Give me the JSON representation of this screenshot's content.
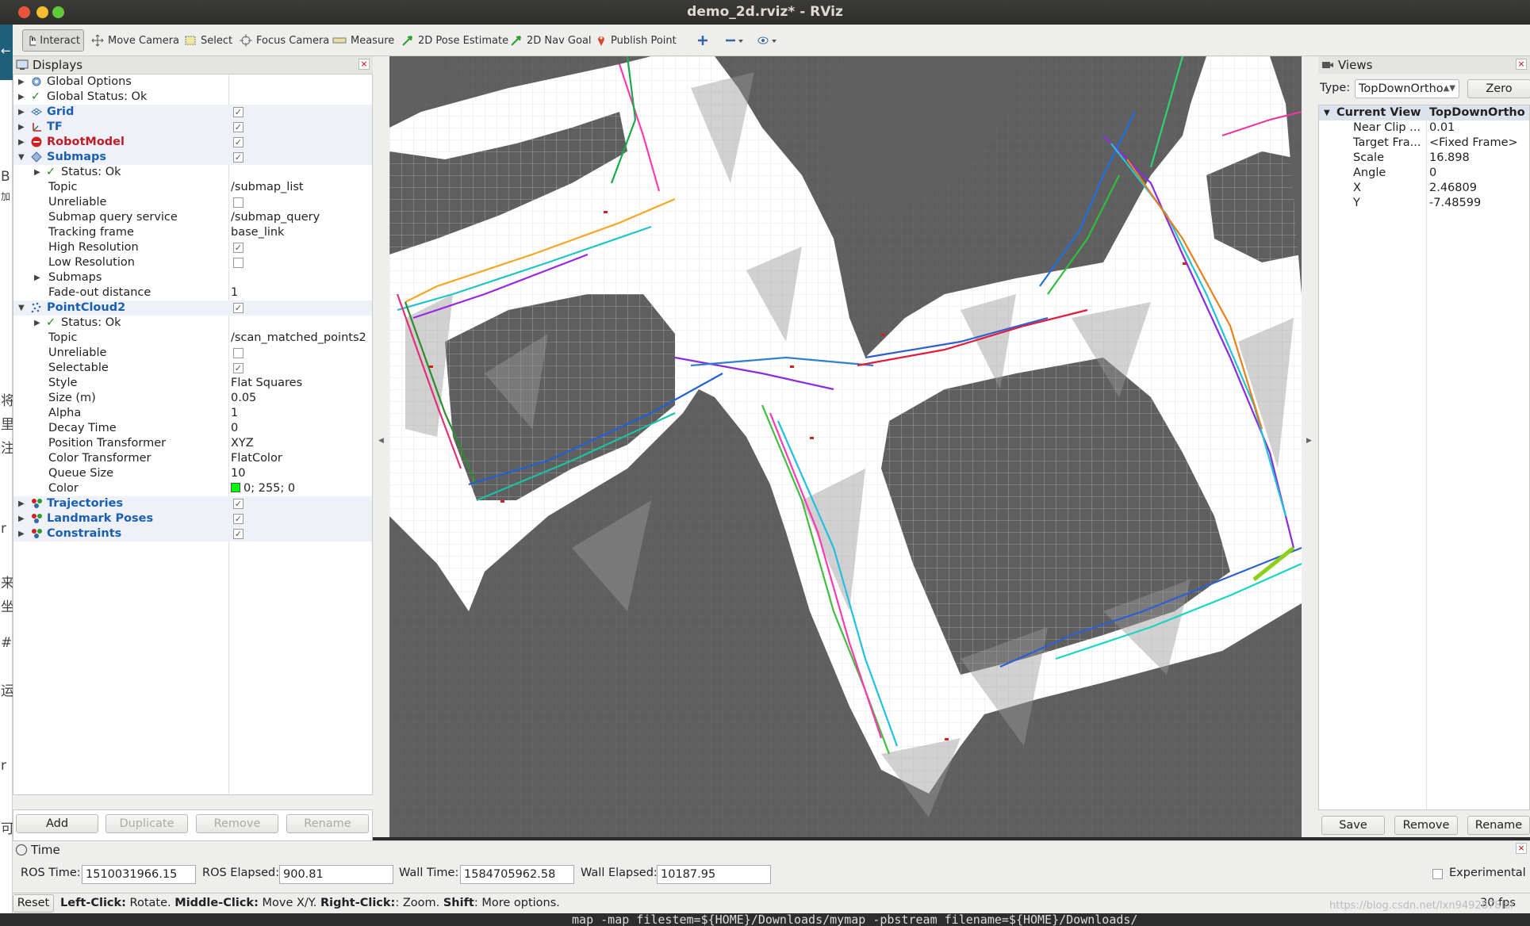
{
  "window": {
    "title": "demo_2d.rviz* - RViz"
  },
  "toolbar": {
    "tools": [
      {
        "label": "Interact"
      },
      {
        "label": "Move Camera"
      },
      {
        "label": "Select"
      },
      {
        "label": "Focus Camera"
      },
      {
        "label": "Measure"
      },
      {
        "label": "2D Pose Estimate"
      },
      {
        "label": "2D Nav Goal"
      },
      {
        "label": "Publish Point"
      }
    ]
  },
  "left_strip": {
    "glyphs": [
      "B",
      "加",
      "将",
      "里",
      "注",
      "r",
      "来",
      "坐",
      "#",
      "运",
      "r",
      "可"
    ]
  },
  "displays": {
    "title": "Displays",
    "rows": [
      {
        "label": "Global Options",
        "value": ""
      },
      {
        "label": "Global Status: Ok",
        "value": ""
      },
      {
        "label": "Grid",
        "value": ""
      },
      {
        "label": "TF",
        "value": ""
      },
      {
        "label": "RobotModel",
        "value": ""
      },
      {
        "label": "Submaps",
        "value": ""
      },
      {
        "label": "Status: Ok",
        "value": ""
      },
      {
        "label": "Topic",
        "value": "/submap_list"
      },
      {
        "label": "Unreliable",
        "value": ""
      },
      {
        "label": "Submap query service",
        "value": "/submap_query"
      },
      {
        "label": "Tracking frame",
        "value": "base_link"
      },
      {
        "label": "High Resolution",
        "value": ""
      },
      {
        "label": "Low Resolution",
        "value": ""
      },
      {
        "label": "Submaps",
        "value": ""
      },
      {
        "label": "Fade-out distance",
        "value": "1"
      },
      {
        "label": "PointCloud2",
        "value": ""
      },
      {
        "label": "Status: Ok",
        "value": ""
      },
      {
        "label": "Topic",
        "value": "/scan_matched_points2"
      },
      {
        "label": "Unreliable",
        "value": ""
      },
      {
        "label": "Selectable",
        "value": ""
      },
      {
        "label": "Style",
        "value": "Flat Squares"
      },
      {
        "label": "Size (m)",
        "value": "0.05"
      },
      {
        "label": "Alpha",
        "value": "1"
      },
      {
        "label": "Decay Time",
        "value": "0"
      },
      {
        "label": "Position Transformer",
        "value": "XYZ"
      },
      {
        "label": "Color Transformer",
        "value": "FlatColor"
      },
      {
        "label": "Queue Size",
        "value": "10"
      },
      {
        "label": "Color",
        "value": "0; 255; 0"
      },
      {
        "label": "Trajectories",
        "value": ""
      },
      {
        "label": "Landmark Poses",
        "value": ""
      },
      {
        "label": "Constraints",
        "value": ""
      }
    ],
    "buttons": {
      "add": "Add",
      "duplicate": "Duplicate",
      "remove": "Remove",
      "rename": "Rename"
    }
  },
  "views": {
    "title": "Views",
    "type_label": "Type:",
    "type_value": "TopDownOrtho",
    "zero_label": "Zero",
    "header_key": "Current View",
    "header_value": "TopDownOrtho ...",
    "rows": [
      {
        "key": "Near Clip ...",
        "value": "0.01"
      },
      {
        "key": "Target Fra...",
        "value": "<Fixed Frame>"
      },
      {
        "key": "Scale",
        "value": "16.898"
      },
      {
        "key": "Angle",
        "value": "0"
      },
      {
        "key": "X",
        "value": "2.46809"
      },
      {
        "key": "Y",
        "value": "-7.48599"
      }
    ],
    "buttons": {
      "save": "Save",
      "remove": "Remove",
      "rename": "Rename"
    }
  },
  "time": {
    "title": "Time",
    "ros_time_label": "ROS Time:",
    "ros_time": "1510031966.15",
    "ros_elapsed_label": "ROS Elapsed:",
    "ros_elapsed": "900.81",
    "wall_time_label": "Wall Time:",
    "wall_time": "1584705962.58",
    "wall_elapsed_label": "Wall Elapsed:",
    "wall_elapsed": "10187.95",
    "experimental_label": "Experimental"
  },
  "status": {
    "reset": "Reset",
    "k1": "Left-Click:",
    "t1": " Rotate. ",
    "k2": "Middle-Click:",
    "t2": " Move X/Y. ",
    "k3": "Right-Click:",
    "t3": ": Zoom. ",
    "k4": "Shift",
    "t4": ": More options.",
    "fps": "30 fps"
  },
  "terminal": {
    "text": "_map -map_filestem=${HOME}/Downloads/mymap -pbstream_filename=${HOME}/Downloads/"
  },
  "watermark": "https://blog.csdn.net/lxn9492878lbl",
  "colors": {
    "map_unknown": "#5f5f5f",
    "map_free": "#ffffff",
    "grid_line": "#cfcfcf",
    "link_blue": "#1a5fb4",
    "robot_red": "#c01c28",
    "pointcloud_color": "#00ff00"
  }
}
